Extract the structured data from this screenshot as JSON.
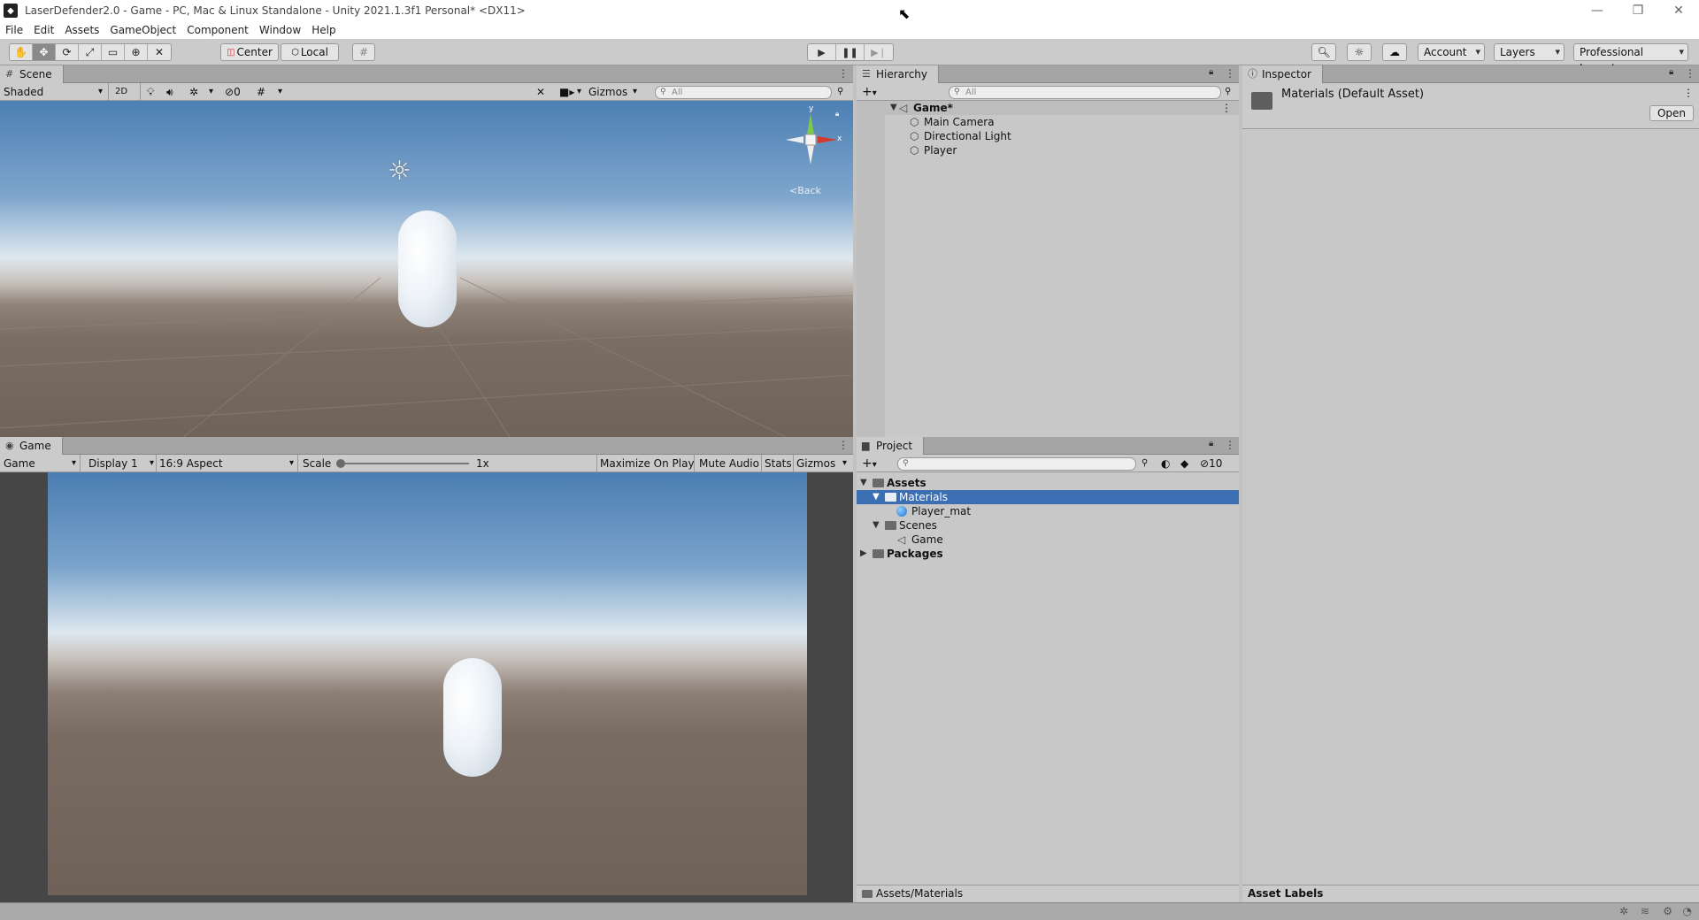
{
  "window": {
    "title": "LaserDefender2.0 - Game - PC, Mac & Linux Standalone - Unity 2021.1.3f1 Personal* <DX11>",
    "controls": [
      "—",
      "❐",
      "✕"
    ]
  },
  "menu": [
    "File",
    "Edit",
    "Assets",
    "GameObject",
    "Component",
    "Window",
    "Help"
  ],
  "toolbar": {
    "center_label": "Center",
    "local_label": "Local",
    "account_label": "Account",
    "layers_label": "Layers",
    "layout_label": "Professional Layout"
  },
  "scene": {
    "tab_label": "Scene",
    "shading_mode": "Shaded",
    "two_d_label": "2D",
    "hidden_count": "0",
    "gizmos_label": "Gizmos",
    "search_placeholder": "All",
    "gizmo_axes": {
      "y": "y",
      "x": "x"
    },
    "back_label": "Back"
  },
  "game": {
    "tab_label": "Game",
    "view_mode": "Game",
    "display": "Display 1",
    "aspect": "16:9 Aspect",
    "scale_label": "Scale",
    "scale_value": "1x",
    "maximize_label": "Maximize On Play",
    "mute_label": "Mute Audio",
    "stats_label": "Stats",
    "gizmos_label": "Gizmos"
  },
  "hierarchy": {
    "tab_label": "Hierarchy",
    "search_placeholder": "All",
    "scene_name": "Game*",
    "objects": [
      "Main Camera",
      "Directional Light",
      "Player"
    ]
  },
  "project": {
    "tab_label": "Project",
    "hidden_packages_count": "10",
    "tree": {
      "assets": "Assets",
      "materials": "Materials",
      "player_mat": "Player_mat",
      "scenes": "Scenes",
      "game_scene": "Game",
      "packages": "Packages"
    },
    "breadcrumb": "Assets/Materials"
  },
  "inspector": {
    "tab_label": "Inspector",
    "asset_title": "Materials (Default Asset)",
    "open_label": "Open",
    "asset_labels": "Asset Labels"
  },
  "colors": {
    "selection": "#3c6eb4",
    "panel_bg": "#c8c8c8",
    "toolbar_bg": "#cbcbcb"
  }
}
